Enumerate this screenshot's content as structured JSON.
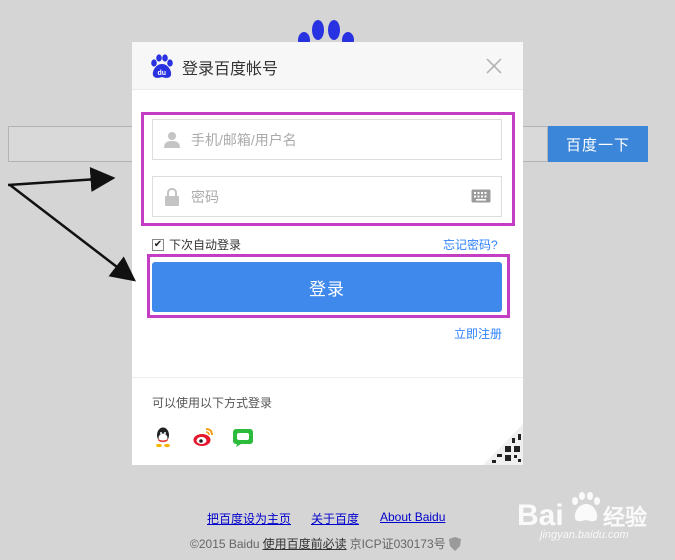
{
  "background": {
    "search_button_label": "百度一下"
  },
  "dialog": {
    "title": "登录百度帐号",
    "username_placeholder": "手机/邮箱/用户名",
    "password_placeholder": "密码",
    "remember_label": "下次自动登录",
    "remember_checked": true,
    "forgot_label": "忘记密码?",
    "login_label": "登录",
    "register_label": "立即注册",
    "alt_login_label": "可以使用以下方式登录",
    "social_icons": [
      "qq-icon",
      "weibo-icon",
      "wechat-icon"
    ]
  },
  "footer": {
    "link_home": "把百度设为主页",
    "link_about": "关于百度",
    "link_about_en": "About  Baidu",
    "copyright": "©2015 Baidu",
    "law_link": "使用百度前必读",
    "icp": "京ICP证030173号"
  },
  "watermark": {
    "logo_text": "Bai",
    "logo_text2": "经验",
    "domain": "jingyan.baidu.com"
  },
  "colors": {
    "accent_blue": "#3f89ec",
    "highlight_magenta": "#c43ec4",
    "link_blue": "#2e82ff"
  }
}
